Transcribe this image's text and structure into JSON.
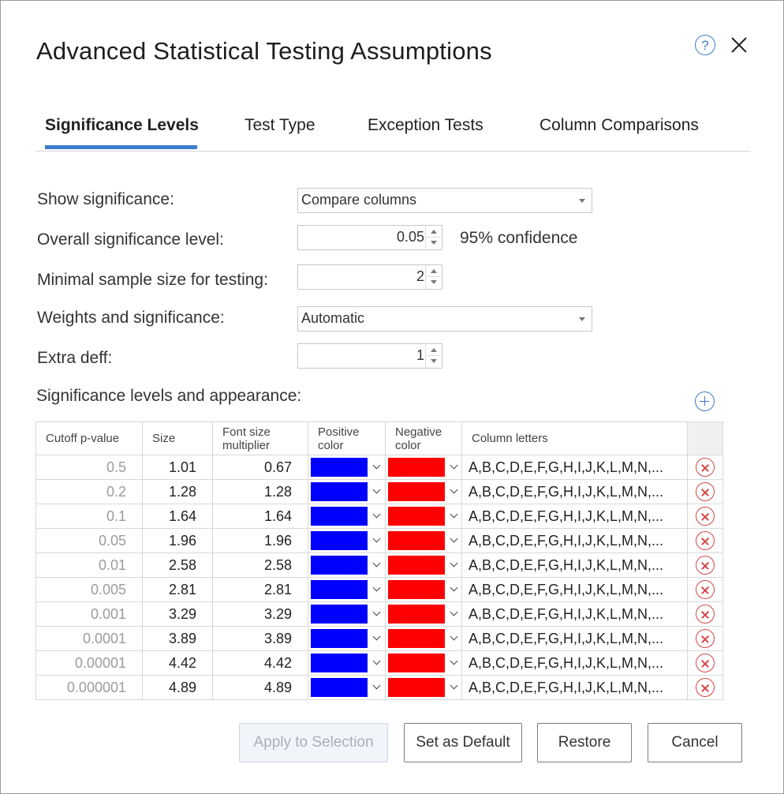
{
  "dialog": {
    "title": "Advanced Statistical Testing Assumptions"
  },
  "tabs": [
    "Significance Levels",
    "Test Type",
    "Exception Tests",
    "Column Comparisons"
  ],
  "fields": {
    "show_significance": {
      "label": "Show significance:",
      "value": "Compare columns"
    },
    "overall_level": {
      "label": "Overall significance level:",
      "value": "0.05",
      "confidence": "95% confidence"
    },
    "min_sample": {
      "label": "Minimal sample size for testing:",
      "value": "2"
    },
    "weights": {
      "label": "Weights and significance:",
      "value": "Automatic"
    },
    "extra_deff": {
      "label": "Extra deff:",
      "value": "1"
    }
  },
  "levels": {
    "label": "Significance levels and appearance:",
    "headers": {
      "cutoff": "Cutoff p-value",
      "size": "Size",
      "font_mult_1": "Font size",
      "font_mult_2": "multiplier",
      "pos_1": "Positive",
      "pos_2": "color",
      "neg_1": "Negative",
      "neg_2": "color",
      "letters": "Column letters"
    },
    "positive_color": "#0000ff",
    "negative_color": "#ff0000",
    "rows": [
      {
        "cutoff": "0.5",
        "size": "1.01",
        "font": "0.67",
        "letters": "A,B,C,D,E,F,G,H,I,J,K,L,M,N,..."
      },
      {
        "cutoff": "0.2",
        "size": "1.28",
        "font": "1.28",
        "letters": "A,B,C,D,E,F,G,H,I,J,K,L,M,N,..."
      },
      {
        "cutoff": "0.1",
        "size": "1.64",
        "font": "1.64",
        "letters": "A,B,C,D,E,F,G,H,I,J,K,L,M,N,..."
      },
      {
        "cutoff": "0.05",
        "size": "1.96",
        "font": "1.96",
        "letters": "A,B,C,D,E,F,G,H,I,J,K,L,M,N,..."
      },
      {
        "cutoff": "0.01",
        "size": "2.58",
        "font": "2.58",
        "letters": "A,B,C,D,E,F,G,H,I,J,K,L,M,N,..."
      },
      {
        "cutoff": "0.005",
        "size": "2.81",
        "font": "2.81",
        "letters": "A,B,C,D,E,F,G,H,I,J,K,L,M,N,..."
      },
      {
        "cutoff": "0.001",
        "size": "3.29",
        "font": "3.29",
        "letters": "A,B,C,D,E,F,G,H,I,J,K,L,M,N,..."
      },
      {
        "cutoff": "0.0001",
        "size": "3.89",
        "font": "3.89",
        "letters": "A,B,C,D,E,F,G,H,I,J,K,L,M,N,..."
      },
      {
        "cutoff": "0.00001",
        "size": "4.42",
        "font": "4.42",
        "letters": "A,B,C,D,E,F,G,H,I,J,K,L,M,N,..."
      },
      {
        "cutoff": "0.000001",
        "size": "4.89",
        "font": "4.89",
        "letters": "A,B,C,D,E,F,G,H,I,J,K,L,M,N,..."
      }
    ]
  },
  "buttons": {
    "apply": "Apply to Selection",
    "set_default": "Set as Default",
    "restore": "Restore",
    "cancel": "Cancel"
  },
  "icons": {
    "help": "?",
    "help_icon": "help-icon",
    "close_icon": "close-icon",
    "add_icon": "add-icon",
    "remove_icon": "remove-icon"
  },
  "colors": {
    "accent": "#3d7cc9",
    "remove": "#d64545"
  }
}
